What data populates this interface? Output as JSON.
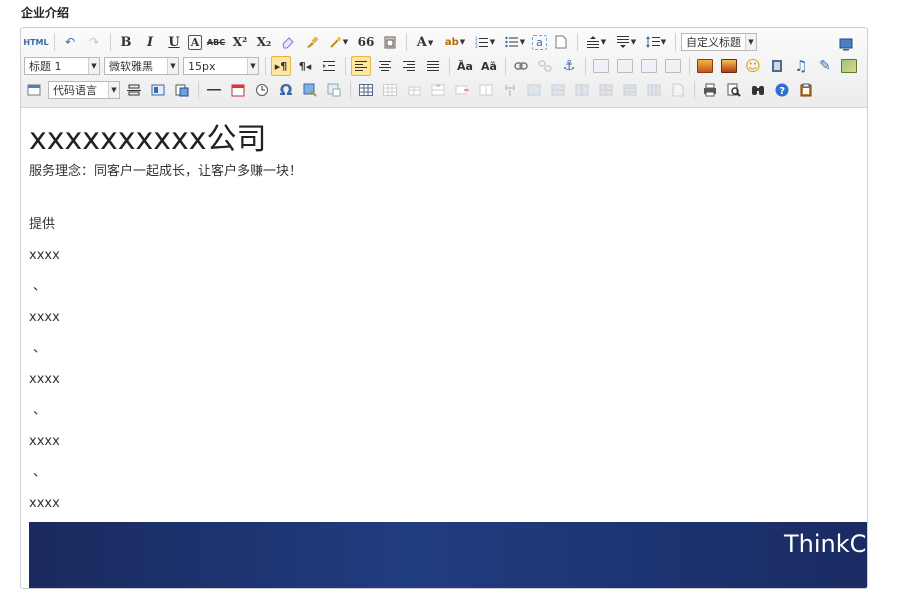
{
  "section": {
    "label": "企业介绍"
  },
  "toolbar": {
    "html_label": "HTML",
    "bold": "B",
    "italic": "I",
    "underline": "U",
    "fontborder": "A",
    "strike": "ABC",
    "superscript": "X²",
    "subscript": "X₂",
    "quote": "66",
    "forecolor": "A",
    "highlight": "ab",
    "custom_style": "自定义标题",
    "paragraph": "标题 1",
    "font_family": "微软雅黑",
    "font_size": "15px",
    "code_lang": "代码语言",
    "omega": "Ω"
  },
  "content": {
    "title": "xxxxxxxxxx公司",
    "slogan": "服务理念：同客户一起成长，让客户多赚一块！",
    "provide": "提供",
    "items": [
      "xxxx",
      "、",
      "xxxx",
      "、",
      "xxxx",
      "、",
      "xxxx",
      "、",
      "xxxx"
    ],
    "banner_text": "ThinkCMF"
  }
}
